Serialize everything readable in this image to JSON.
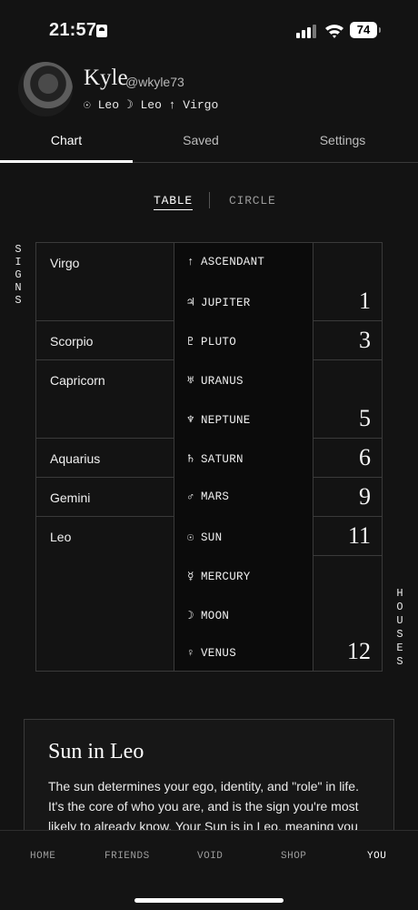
{
  "status_bar": {
    "time": "21:57",
    "battery": "74"
  },
  "profile": {
    "name": "Kyle",
    "handle": "@wkyle73",
    "signs": "☉ Leo ☽ Leo ↑ Virgo"
  },
  "tabs": [
    {
      "label": "Chart",
      "active": true
    },
    {
      "label": "Saved",
      "active": false
    },
    {
      "label": "Settings",
      "active": false
    }
  ],
  "view_toggle": {
    "table": "TABLE",
    "circle": "CIRCLE",
    "selected": "TABLE"
  },
  "side_labels": {
    "signs": [
      "S",
      "I",
      "G",
      "N",
      "S"
    ],
    "houses": [
      "H",
      "O",
      "U",
      "S",
      "E",
      "S"
    ]
  },
  "signs_column": [
    {
      "label": "Virgo"
    },
    {
      "label": "Scorpio"
    },
    {
      "label": "Capricorn"
    },
    {
      "label": "Aquarius"
    },
    {
      "label": "Gemini"
    },
    {
      "label": "Leo"
    }
  ],
  "planets_column": [
    {
      "glyph": "↑",
      "label": "ASCENDANT"
    },
    {
      "glyph": "♃",
      "label": "JUPITER"
    },
    {
      "glyph": "♇",
      "label": "PLUTO"
    },
    {
      "glyph": "♅",
      "label": "URANUS"
    },
    {
      "glyph": "♆",
      "label": "NEPTUNE"
    },
    {
      "glyph": "♄",
      "label": "SATURN"
    },
    {
      "glyph": "♂",
      "label": "MARS"
    },
    {
      "glyph": "☉",
      "label": "SUN"
    },
    {
      "glyph": "☿",
      "label": "MERCURY"
    },
    {
      "glyph": "☽",
      "label": "MOON"
    },
    {
      "glyph": "♀",
      "label": "VENUS"
    }
  ],
  "houses_column": [
    {
      "label": "1"
    },
    {
      "label": "3"
    },
    {
      "label": "5"
    },
    {
      "label": "6"
    },
    {
      "label": "9"
    },
    {
      "label": "11"
    },
    {
      "label": "12"
    }
  ],
  "detail_card": {
    "title": "Sun in Leo",
    "text": "The sun determines your ego, identity, and \"role\" in life. It's the core of who you are, and is the sign you're most likely to already know. Your Sun is in Leo, meaning you"
  },
  "bottom_nav": [
    {
      "label": "HOME",
      "active": false
    },
    {
      "label": "FRIENDS",
      "active": false
    },
    {
      "label": "VOID",
      "active": false
    },
    {
      "label": "SHOP",
      "active": false
    },
    {
      "label": "YOU",
      "active": true
    }
  ]
}
